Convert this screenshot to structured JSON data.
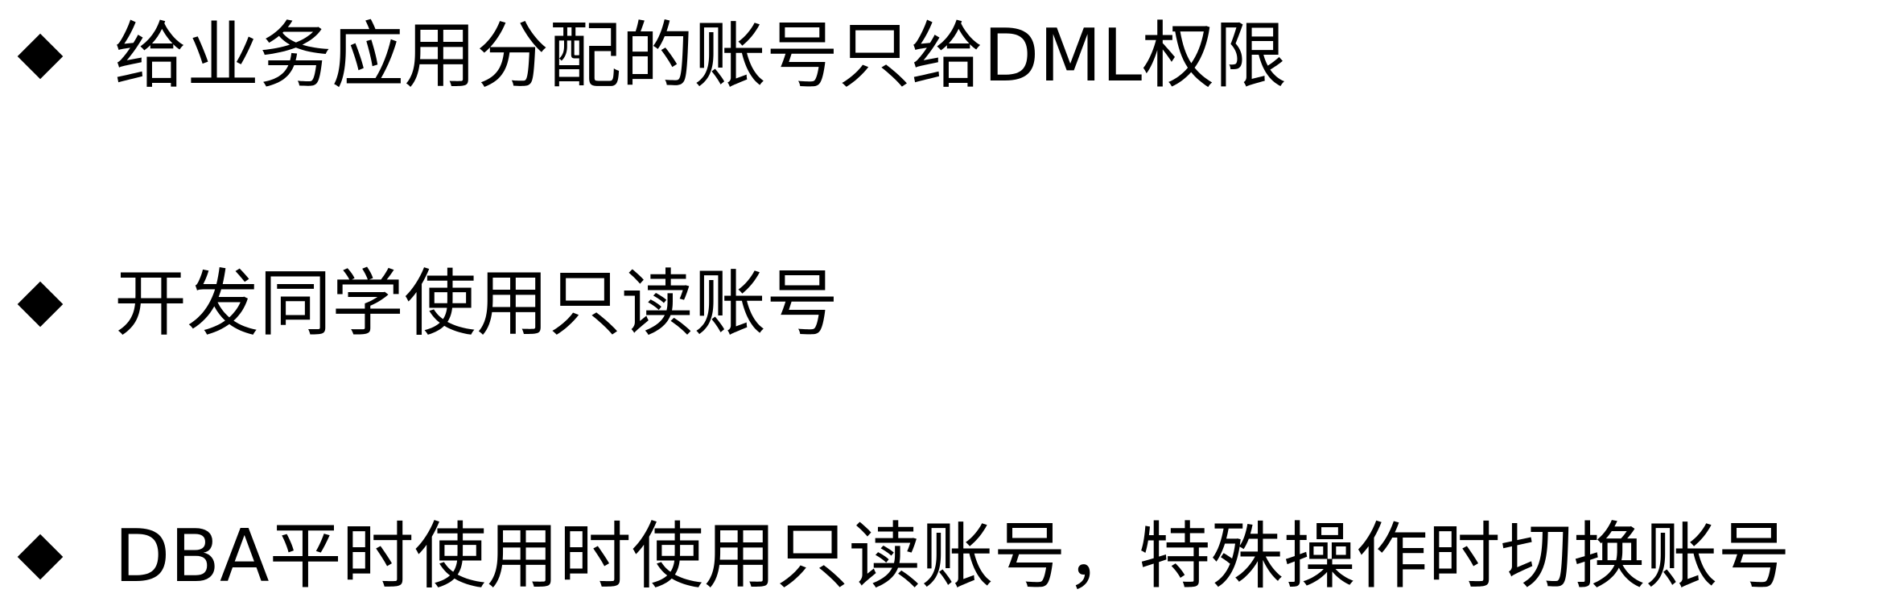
{
  "slide": {
    "bullets": [
      {
        "icon": "diamond-bullet-icon",
        "text": "给业务应用分配的账号只给DML权限"
      },
      {
        "icon": "diamond-bullet-icon",
        "text": "开发同学使用只读账号"
      },
      {
        "icon": "diamond-bullet-icon",
        "text": "DBA平时使用时使用只读账号，特殊操作时切换账号"
      }
    ],
    "colors": {
      "background": "#ffffff",
      "text": "#000000",
      "bullet": "#000000"
    }
  }
}
